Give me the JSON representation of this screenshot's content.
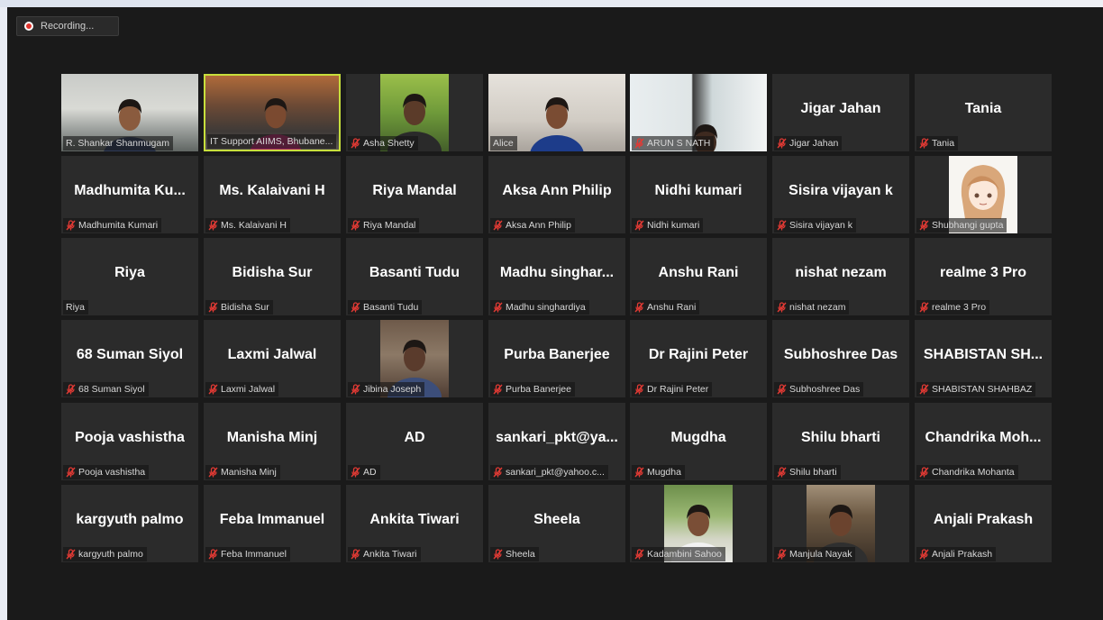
{
  "recording": {
    "label": "Recording..."
  },
  "tiles": [
    {
      "big": "",
      "label": "R. Shankar Shanmugam",
      "mic": false,
      "video": "office"
    },
    {
      "big": "",
      "label": "IT Support AIIMS, Bhubane...",
      "mic": false,
      "video": "room",
      "active": true
    },
    {
      "big": "",
      "label": "Asha Shetty",
      "mic": true,
      "video": "green"
    },
    {
      "big": "",
      "label": "Alice",
      "mic": false,
      "video": "white"
    },
    {
      "big": "",
      "label": "ARUN S NATH",
      "mic": true,
      "video": "window"
    },
    {
      "big": "Jigar Jahan",
      "label": "Jigar Jahan",
      "mic": true
    },
    {
      "big": "Tania",
      "label": "Tania",
      "mic": true
    },
    {
      "big": "Madhumita Ku...",
      "label": "Madhumita Kumari",
      "mic": true
    },
    {
      "big": "Ms. Kalaivani H",
      "label": "Ms. Kalaivani H",
      "mic": true
    },
    {
      "big": "Riya Mandal",
      "label": "Riya Mandal",
      "mic": true
    },
    {
      "big": "Aksa Ann Philip",
      "label": "Aksa Ann Philip",
      "mic": true
    },
    {
      "big": "Nidhi kumari",
      "label": "Nidhi kumari",
      "mic": true
    },
    {
      "big": "Sisira vijayan k",
      "label": "Sisira vijayan k",
      "mic": true
    },
    {
      "big": "",
      "label": "Shubhangi gupta",
      "mic": true,
      "video": "anime"
    },
    {
      "big": "Riya",
      "label": "Riya",
      "mic": false
    },
    {
      "big": "Bidisha Sur",
      "label": "Bidisha Sur",
      "mic": true
    },
    {
      "big": "Basanti Tudu",
      "label": "Basanti Tudu",
      "mic": true
    },
    {
      "big": "Madhu singhar...",
      "label": "Madhu singhardiya",
      "mic": true
    },
    {
      "big": "Anshu Rani",
      "label": "Anshu Rani",
      "mic": true
    },
    {
      "big": "nishat nezam",
      "label": "nishat nezam",
      "mic": true
    },
    {
      "big": "realme 3 Pro",
      "label": "realme 3 Pro",
      "mic": true
    },
    {
      "big": "68 Suman Siyol",
      "label": "68 Suman Siyol",
      "mic": true
    },
    {
      "big": "Laxmi Jalwal",
      "label": "Laxmi Jalwal",
      "mic": true
    },
    {
      "big": "",
      "label": "Jibina Joseph",
      "mic": true,
      "video": "girl1"
    },
    {
      "big": "Purba Banerjee",
      "label": "Purba Banerjee",
      "mic": true
    },
    {
      "big": "Dr Rajini Peter",
      "label": "Dr Rajini Peter",
      "mic": true
    },
    {
      "big": "Subhoshree Das",
      "label": "Subhoshree Das",
      "mic": true
    },
    {
      "big": "SHABISTAN SH...",
      "label": "SHABISTAN SHAHBAZ",
      "mic": true
    },
    {
      "big": "Pooja vashistha",
      "label": "Pooja vashistha",
      "mic": true
    },
    {
      "big": "Manisha Minj",
      "label": "Manisha Minj",
      "mic": true
    },
    {
      "big": "AD",
      "label": "AD",
      "mic": true
    },
    {
      "big": "sankari_pkt@ya...",
      "label": "sankari_pkt@yahoo.c...",
      "mic": true
    },
    {
      "big": "Mugdha",
      "label": "Mugdha",
      "mic": true
    },
    {
      "big": "Shilu bharti",
      "label": "Shilu bharti",
      "mic": true
    },
    {
      "big": "Chandrika Moh...",
      "label": "Chandrika Mohanta",
      "mic": true
    },
    {
      "big": "kargyuth palmo",
      "label": "kargyuth palmo",
      "mic": true
    },
    {
      "big": "Feba Immanuel",
      "label": "Feba Immanuel",
      "mic": true
    },
    {
      "big": "Ankita Tiwari",
      "label": "Ankita Tiwari",
      "mic": true
    },
    {
      "big": "Sheela",
      "label": "Sheela",
      "mic": true
    },
    {
      "big": "",
      "label": "Kadambini Sahoo",
      "mic": true,
      "video": "girl2"
    },
    {
      "big": "",
      "label": "Manjula Nayak",
      "mic": true,
      "video": "girl3"
    },
    {
      "big": "Anjali Prakash",
      "label": "Anjali Prakash",
      "mic": true
    }
  ],
  "colors": {
    "active_border": "#c7df3c",
    "mute": "#e23a34",
    "tile_bg": "#2b2b2b"
  },
  "icons": {
    "mute": "mic-muted-icon",
    "record": "record-dot-icon"
  }
}
